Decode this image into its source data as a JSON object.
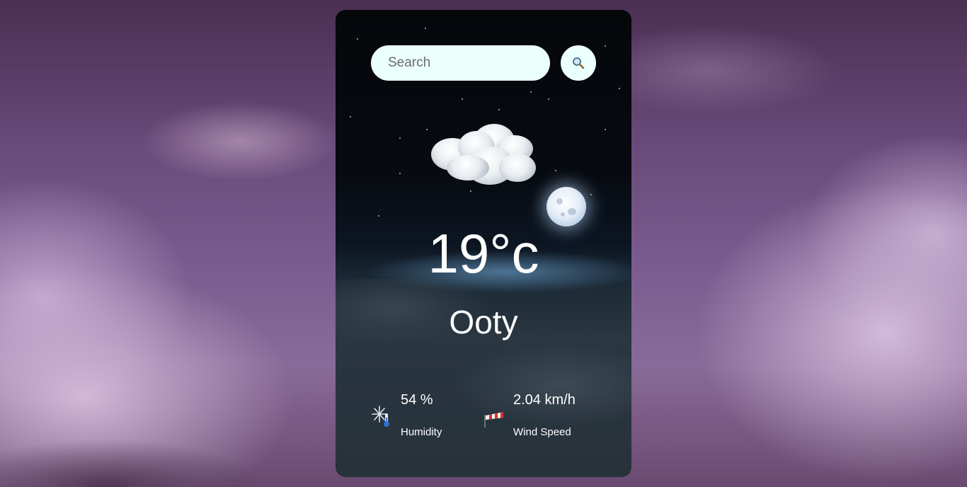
{
  "search": {
    "placeholder": "Search",
    "value": ""
  },
  "weather": {
    "condition_icon": "cloudy-night-icon",
    "temperature": "19°c",
    "city": "Ooty"
  },
  "details": {
    "humidity": {
      "icon": "humidity-thermometer-icon",
      "value": "54 %",
      "label": "Humidity"
    },
    "wind": {
      "icon": "windsock-icon",
      "value": "2.04 km/h",
      "label": "Wind Speed"
    }
  },
  "colors": {
    "input_background": "#ebfffc",
    "text": "#ffffff"
  }
}
